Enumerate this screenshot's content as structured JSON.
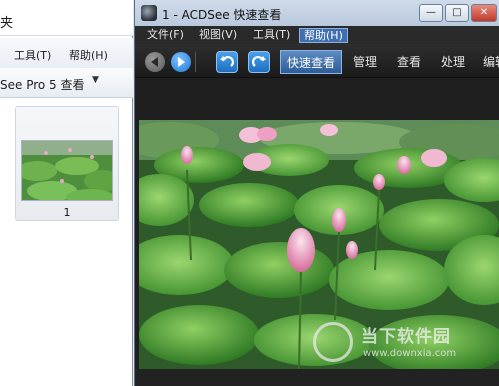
{
  "explorer": {
    "title_fragment": "夹",
    "menu": {
      "tools": "工具(T)",
      "help": "帮助(H)"
    },
    "view_label": "See Pro 5 查看",
    "thumbnail": {
      "label": "1"
    }
  },
  "viewer": {
    "window_title": "1 - ACDSee 快速查看",
    "window_buttons": {
      "minimize": "—",
      "maximize": "□",
      "close": "✕"
    },
    "menu": [
      {
        "label": "文件(F)"
      },
      {
        "label": "视图(V)"
      },
      {
        "label": "工具(T)"
      },
      {
        "label": "帮助(H)",
        "active": true
      }
    ],
    "toolbar": {
      "tabs": [
        {
          "label": "快速查看",
          "active": true
        },
        {
          "label": "管理"
        },
        {
          "label": "查看"
        },
        {
          "label": "处理"
        },
        {
          "label": "编辑"
        }
      ]
    },
    "watermark": {
      "main": "当下软件园",
      "sub": "www.downxia.com"
    },
    "colors": {
      "accent": "#3f6fae",
      "tab_active": "#4a78b0",
      "nav_button": "#1e7bd6"
    }
  }
}
